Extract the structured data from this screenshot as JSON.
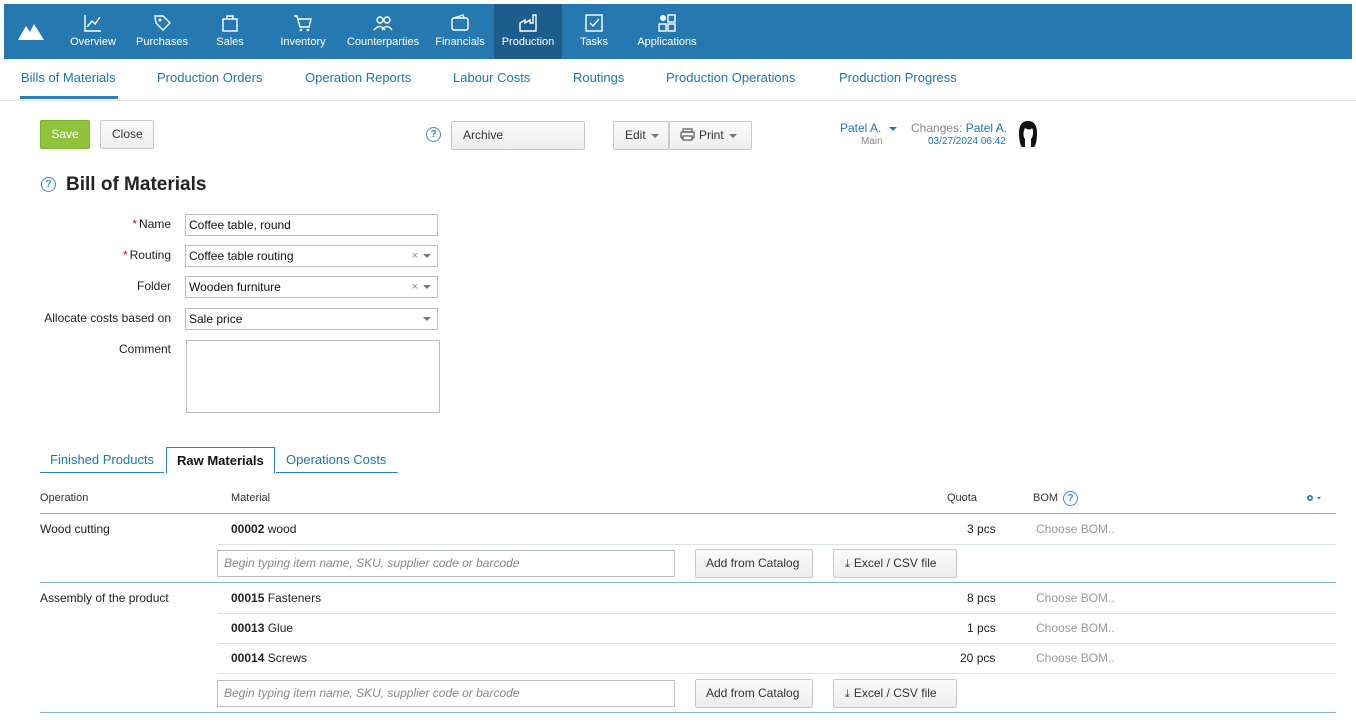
{
  "topnav": {
    "items": [
      {
        "label": "Overview",
        "icon": "chart-line-icon"
      },
      {
        "label": "Purchases",
        "icon": "price-tag-icon"
      },
      {
        "label": "Sales",
        "icon": "shopping-bag-icon"
      },
      {
        "label": "Inventory",
        "icon": "cart-icon"
      },
      {
        "label": "Counterparties",
        "icon": "people-icon"
      },
      {
        "label": "Financials",
        "icon": "wallet-icon"
      },
      {
        "label": "Production",
        "icon": "factory-icon"
      },
      {
        "label": "Tasks",
        "icon": "checkbox-icon"
      },
      {
        "label": "Applications",
        "icon": "apps-grid-icon"
      }
    ],
    "active": "Production",
    "bar_color": "#2679b0",
    "active_color": "#1d5d8c"
  },
  "subnav": {
    "items": [
      "Bills of Materials",
      "Production Orders",
      "Operation Reports",
      "Labour Costs",
      "Routings",
      "Production Operations",
      "Production Progress"
    ],
    "active": "Bills of Materials"
  },
  "toolbar": {
    "save_label": "Save",
    "close_label": "Close",
    "help_symbol": "?",
    "archive_label": "Archive",
    "edit_label": "Edit",
    "print_label": "Print"
  },
  "owner": {
    "name": "Patel A.",
    "group": "Main",
    "changes_label": "Changes:",
    "changes_user": "Patel A.",
    "changes_date": "03/27/2024 06:42"
  },
  "page": {
    "title": "Bill of Materials"
  },
  "form": {
    "name_label": "Name",
    "name_value": "Coffee table, round",
    "routing_label": "Routing",
    "routing_value": "Coffee table routing",
    "folder_label": "Folder",
    "folder_value": "Wooden furniture",
    "allocate_label": "Allocate costs based on",
    "allocate_value": "Sale price",
    "comment_label": "Comment",
    "comment_value": "",
    "required_mark": "*",
    "clear_symbol": "×"
  },
  "tabs": {
    "items": [
      "Finished Products",
      "Raw Materials",
      "Operations Costs"
    ],
    "active": "Raw Materials"
  },
  "table": {
    "columns": {
      "operation": "Operation",
      "material": "Material",
      "quota": "Quota",
      "bom": "BOM"
    },
    "groups": [
      {
        "operation": "Wood cutting",
        "rows": [
          {
            "code": "00002",
            "name": "wood",
            "quota": "3",
            "unit": "pcs",
            "bom": "Choose BOM.."
          }
        ]
      },
      {
        "operation": "Assembly of the product",
        "rows": [
          {
            "code": "00015",
            "name": "Fasteners",
            "quota": "8",
            "unit": "pcs",
            "bom": "Choose BOM.."
          },
          {
            "code": "00013",
            "name": "Glue",
            "quota": "1",
            "unit": "pcs",
            "bom": "Choose BOM.."
          },
          {
            "code": "00014",
            "name": "Screws",
            "quota": "20",
            "unit": "pcs",
            "bom": "Choose BOM.."
          }
        ]
      }
    ],
    "search_placeholder": "Begin typing item name, SKU, supplier code or barcode",
    "add_catalog_label": "Add from Catalog",
    "excel_label": "Excel / CSV file"
  }
}
